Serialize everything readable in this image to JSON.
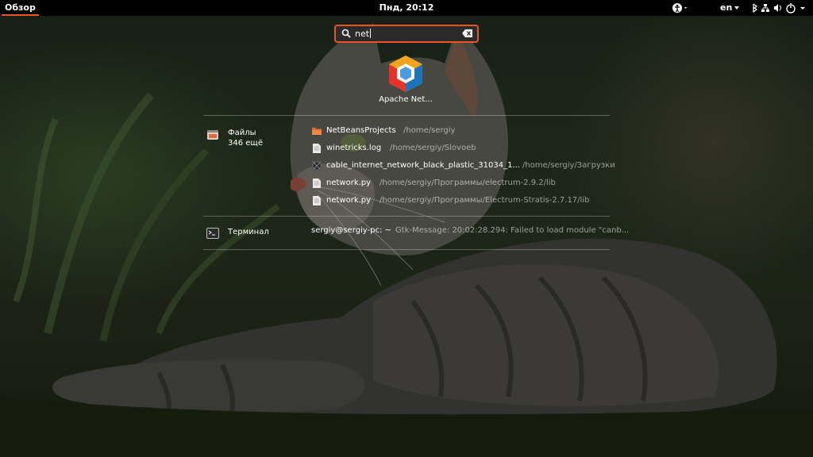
{
  "topbar": {
    "activities": "Обзор",
    "clock": "Пнд, 20:12",
    "keyboard_layout": "en"
  },
  "search": {
    "value": "net"
  },
  "apps": [
    {
      "label": "Apache Net..."
    }
  ],
  "providers": {
    "files": {
      "name": "Файлы",
      "more": "346 ещё",
      "results": [
        {
          "title": "NetBeansProjects",
          "path": "/home/sergiy",
          "icon": "folder-icon"
        },
        {
          "title": "winetricks.log",
          "path": "/home/sergiy/Slovoeb",
          "icon": "text-file-icon"
        },
        {
          "title": "cable_internet_network_black_plastic_31034_1...",
          "path": "/home/sergiy/Загрузки",
          "icon": "image-file-icon"
        },
        {
          "title": "network.py",
          "path": "/home/sergiy/Программы/electrum-2.9.2/lib",
          "icon": "text-file-icon"
        },
        {
          "title": "network.py",
          "path": "/home/sergiy/Программы/Electrum-Stratis-2.7.17/lib",
          "icon": "text-file-icon"
        }
      ]
    },
    "terminal": {
      "name": "Терминал",
      "results": [
        {
          "title": "sergiy@sergiy-pc: ~",
          "description": "Gtk-Message: 20:02:28.294: Failed to load module \"canb..."
        }
      ]
    }
  },
  "colors": {
    "accent": "#e95420",
    "topbar_bg": "#000000"
  }
}
